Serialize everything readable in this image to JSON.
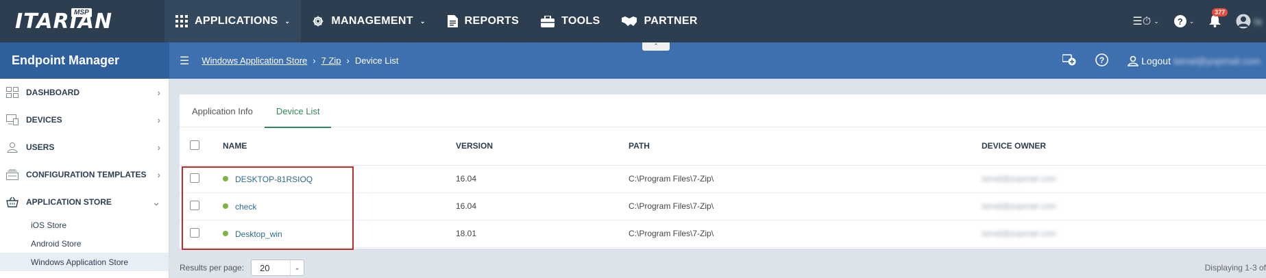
{
  "brand": {
    "logo": "ITARIAN",
    "tier": "MSP"
  },
  "topnav": {
    "items": [
      {
        "label": "APPLICATIONS",
        "icon": "grid-icon",
        "dropdown": true
      },
      {
        "label": "MANAGEMENT",
        "icon": "gear-icon",
        "dropdown": true
      },
      {
        "label": "REPORTS",
        "icon": "document-icon",
        "dropdown": false
      },
      {
        "label": "TOOLS",
        "icon": "toolbox-icon",
        "dropdown": false
      },
      {
        "label": "PARTNER",
        "icon": "handshake-icon",
        "dropdown": false
      }
    ],
    "notification_count": "377",
    "user_initials": "ta"
  },
  "subbar": {
    "module_title": "Endpoint Manager",
    "breadcrumbs": [
      "Windows Application Store",
      "7 Zip",
      "Device List"
    ],
    "logout_label": "Logout",
    "user_email": "tamal@yopmail.com"
  },
  "sidebar": {
    "items": [
      {
        "label": "DASHBOARD",
        "icon": "dashboard-icon"
      },
      {
        "label": "DEVICES",
        "icon": "devices-icon"
      },
      {
        "label": "USERS",
        "icon": "user-icon"
      },
      {
        "label": "CONFIGURATION TEMPLATES",
        "icon": "templates-icon"
      },
      {
        "label": "APPLICATION STORE",
        "icon": "basket-icon"
      }
    ],
    "subitems": [
      "iOS Store",
      "Android Store",
      "Windows Application Store"
    ]
  },
  "tabs": [
    "Application Info",
    "Device List"
  ],
  "table": {
    "headers": [
      "NAME",
      "VERSION",
      "PATH",
      "DEVICE OWNER"
    ],
    "rows": [
      {
        "name": "DESKTOP-81RSIOQ",
        "version": "16.04",
        "path": "C:\\Program Files\\7-Zip\\",
        "owner": "tamal@yopmail.com"
      },
      {
        "name": "check",
        "version": "16.04",
        "path": "C:\\Program Files\\7-Zip\\",
        "owner": "tamal@yopmail.com"
      },
      {
        "name": "Desktop_win",
        "version": "18.01",
        "path": "C:\\Program Files\\7-Zip\\",
        "owner": "tamal@yopmail.com"
      }
    ]
  },
  "footer": {
    "results_label": "Results per page:",
    "results_value": "20",
    "display_text": "Displaying 1-3 of"
  },
  "colors": {
    "topnav": "#2c3e50",
    "subbar": "#3e6fae",
    "accent": "#2e8b57",
    "highlight": "#c62828",
    "status_online": "#7cb342"
  }
}
